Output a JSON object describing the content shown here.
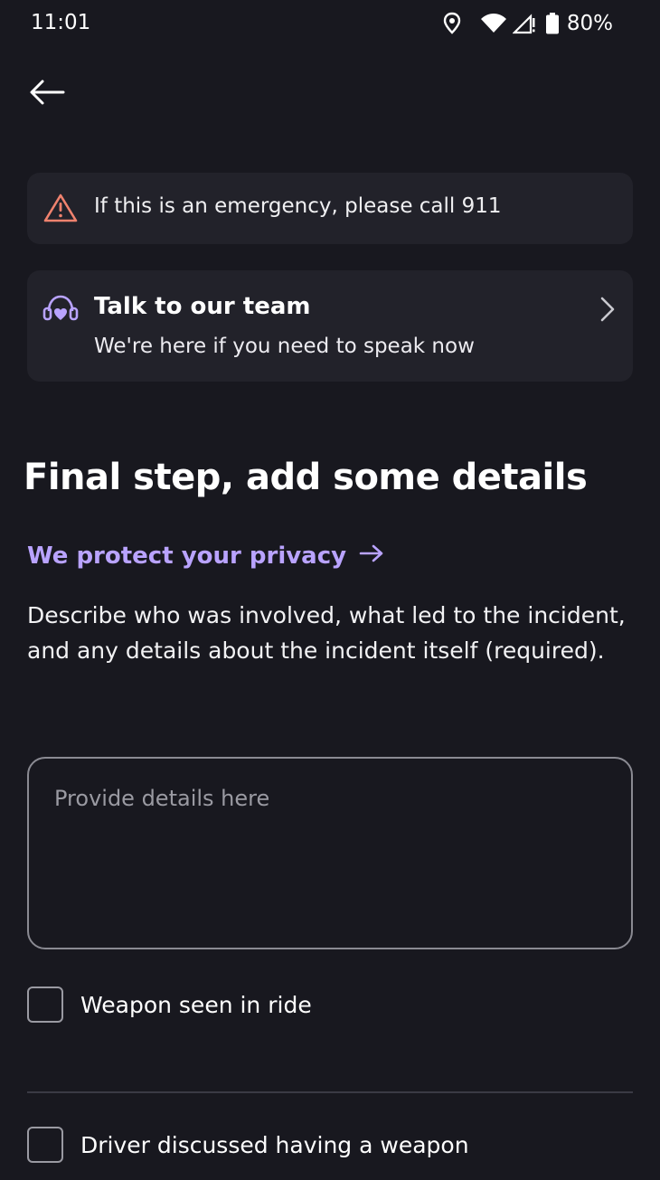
{
  "status_bar": {
    "time": "11:01",
    "battery": "80%",
    "icons": [
      "location-icon",
      "wifi-icon",
      "signal-icon",
      "battery-icon"
    ]
  },
  "nav": {
    "back_icon": "arrow-left-icon"
  },
  "emergency_banner": {
    "icon": "warning-triangle-icon",
    "text": "If this is an emergency, please call 911",
    "icon_color": "#f0826e"
  },
  "team_card": {
    "icon": "support-headset-icon",
    "title": "Talk to our team",
    "subtitle": "We're here if you need to speak now",
    "icon_color": "#b9a3ff"
  },
  "form": {
    "heading": "Final step, add some details",
    "privacy_link": "We protect your privacy",
    "privacy_link_color": "#b9a3ff",
    "description": "Describe who was involved, what led to the incident, and any details about the incident itself (required).",
    "details_value": "",
    "details_placeholder": "Provide details here",
    "checkboxes": [
      {
        "label": "Weapon seen in ride",
        "checked": false
      },
      {
        "label": "Driver discussed having a weapon",
        "checked": false
      }
    ]
  },
  "theme": {
    "background": "#18181f",
    "card": "#22222a"
  }
}
